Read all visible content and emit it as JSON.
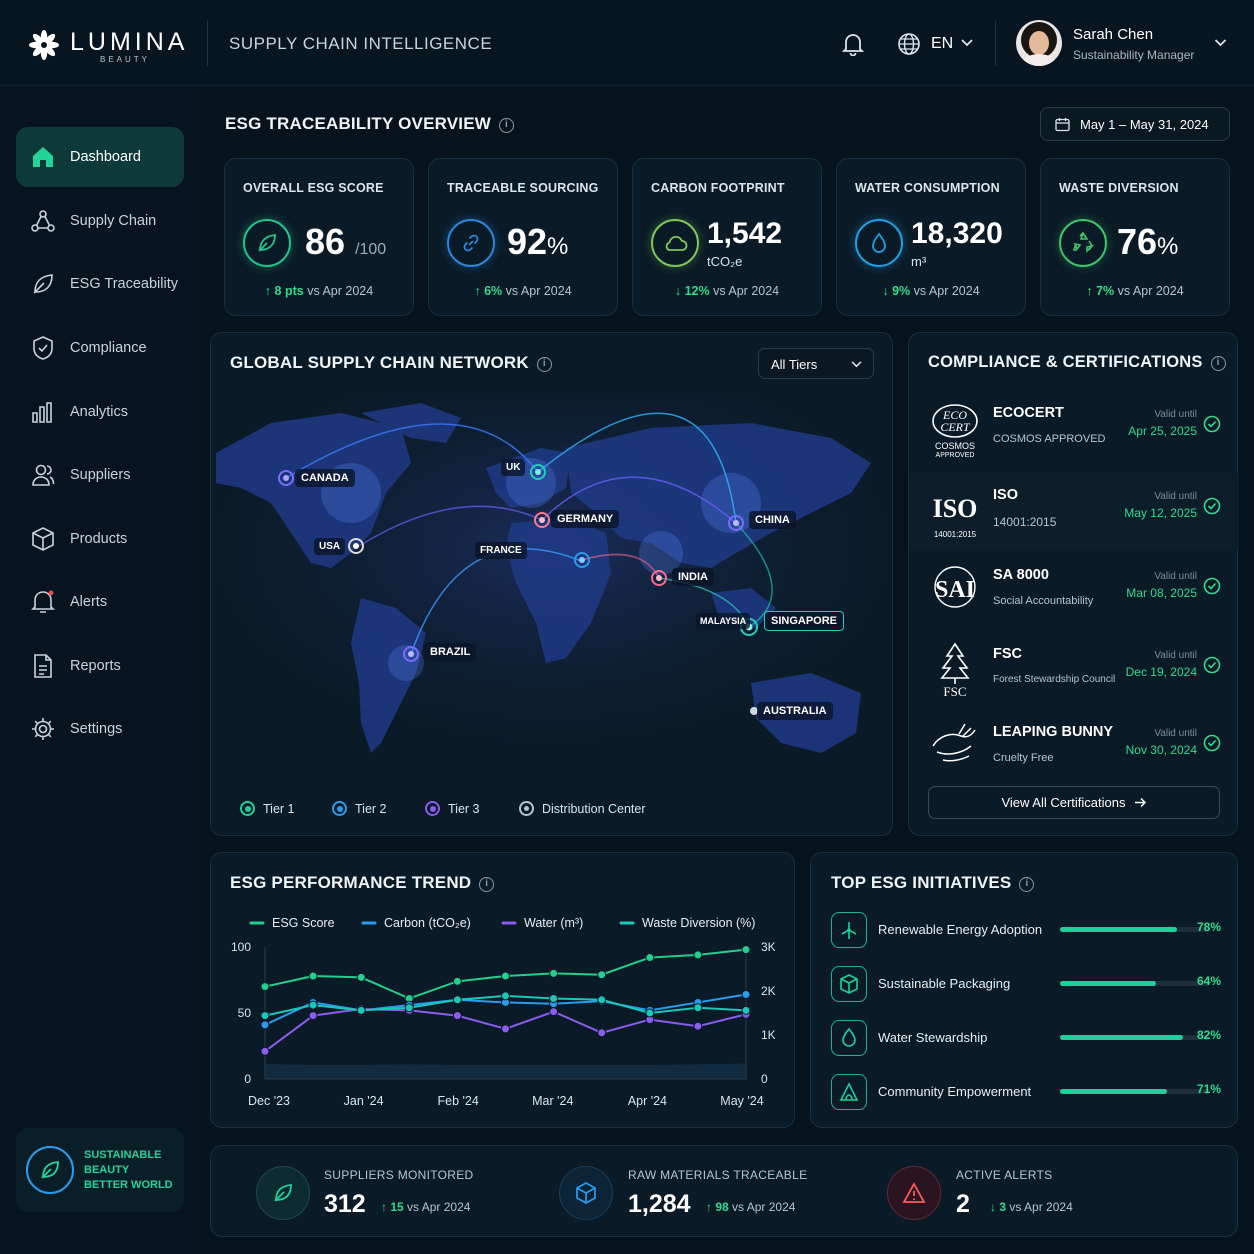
{
  "brand": {
    "name": "LUMINA",
    "sub": "BEAUTY"
  },
  "header": {
    "section": "SUPPLY CHAIN INTELLIGENCE",
    "lang": "EN",
    "user_name": "Sarah Chen",
    "user_role": "Sustainability Manager"
  },
  "sidebar": {
    "items": [
      {
        "label": "Dashboard",
        "icon": "home-icon"
      },
      {
        "label": "Supply Chain",
        "icon": "network-icon"
      },
      {
        "label": "ESG Traceability",
        "icon": "leaf-icon"
      },
      {
        "label": "Compliance",
        "icon": "shield-check-icon"
      },
      {
        "label": "Analytics",
        "icon": "bar-chart-icon"
      },
      {
        "label": "Suppliers",
        "icon": "users-icon"
      },
      {
        "label": "Products",
        "icon": "box-icon"
      },
      {
        "label": "Alerts",
        "icon": "bell-icon"
      },
      {
        "label": "Reports",
        "icon": "document-icon"
      },
      {
        "label": "Settings",
        "icon": "gear-icon"
      }
    ],
    "badge": {
      "l1": "SUSTAINABLE",
      "l2": "BEAUTY",
      "l3": "BETTER WORLD"
    }
  },
  "overview": {
    "title": "ESG TRACEABILITY OVERVIEW",
    "date_range": "May 1 – May 31, 2024"
  },
  "kpis": [
    {
      "title": "OVERALL ESG SCORE",
      "value": "86",
      "unit": "/100",
      "delta": "8 pts",
      "compare": "vs Apr 2024",
      "dir": "up",
      "color": "#23c48a",
      "icon": "leaf-icon"
    },
    {
      "title": "TRACEABLE SOURCING",
      "value": "92",
      "unit": "%",
      "delta": "6%",
      "compare": "vs Apr 2024",
      "dir": "up",
      "color": "#2a86e0",
      "icon": "link-icon"
    },
    {
      "title": "CARBON FOOTPRINT",
      "value": "1,542",
      "unit": "tCO₂e",
      "delta": "12%",
      "compare": "vs Apr 2024",
      "dir": "down",
      "color": "#7ec85a",
      "icon": "cloud-icon"
    },
    {
      "title": "WATER CONSUMPTION",
      "value": "18,320",
      "unit": "m³",
      "delta": "9%",
      "compare": "vs Apr 2024",
      "dir": "down",
      "color": "#1ea0e8",
      "icon": "water-drop-icon"
    },
    {
      "title": "WASTE DIVERSION",
      "value": "76",
      "unit": "%",
      "delta": "7%",
      "compare": "vs Apr 2024",
      "dir": "up",
      "color": "#3fc46a",
      "icon": "recycle-icon"
    }
  ],
  "network": {
    "title": "GLOBAL SUPPLY CHAIN NETWORK",
    "filter": "All Tiers",
    "locations": [
      "CANADA",
      "USA",
      "UK",
      "GERMANY",
      "FRANCE",
      "CHINA",
      "INDIA",
      "SINGAPORE",
      "MALAYSIA",
      "BRAZIL",
      "AUSTRALIA"
    ],
    "legend": [
      "Tier 1",
      "Tier 2",
      "Tier 3",
      "Distribution Center"
    ]
  },
  "compliance": {
    "title": "COMPLIANCE & CERTIFICATIONS",
    "valid_label": "Valid until",
    "button": "View All Certifications",
    "items": [
      {
        "name": "ECOCERT",
        "sub": "COSMOS APPROVED",
        "date": "Apr 25, 2025",
        "logo": "ecocert-logo"
      },
      {
        "name": "ISO",
        "sub": "14001:2015",
        "date": "May 12, 2025",
        "logo": "iso-logo"
      },
      {
        "name": "SA 8000",
        "sub": "Social Accountability",
        "date": "Mar 08, 2025",
        "logo": "sa8000-logo"
      },
      {
        "name": "FSC",
        "sub": "Forest Stewardship Council",
        "date": "Dec 19, 2024",
        "logo": "fsc-tree-logo"
      },
      {
        "name": "LEAPING BUNNY",
        "sub": "Cruelty Free",
        "date": "Nov 30, 2024",
        "logo": "leaping-bunny-logo"
      }
    ]
  },
  "trend": {
    "title": "ESG PERFORMANCE TREND"
  },
  "chart_data": {
    "type": "line",
    "title": "ESG PERFORMANCE TREND",
    "x": [
      "Dec '23",
      "",
      "Jan '24",
      "",
      "Feb '24",
      "",
      "Mar '24",
      "",
      "Apr '24",
      "",
      "May '24"
    ],
    "x_ticks": [
      "Dec '23",
      "Jan '24",
      "Feb '24",
      "Mar '24",
      "Apr '24",
      "May '24"
    ],
    "y_left": {
      "ticks": [
        "100",
        "50",
        "0"
      ],
      "range": [
        0,
        100
      ]
    },
    "y_right": {
      "ticks": [
        "3K",
        "2K",
        "1K",
        "0"
      ],
      "range": [
        0,
        3000
      ]
    },
    "series": [
      {
        "name": "ESG Score",
        "color": "#22d08e",
        "axis": "left",
        "values": [
          70,
          78,
          77,
          61,
          74,
          78,
          80,
          79,
          92,
          94,
          98
        ]
      },
      {
        "name": "Carbon (tCO₂e)",
        "color": "#2a9cf0",
        "axis": "left",
        "values": [
          41,
          58,
          52,
          56,
          60,
          58,
          57,
          59,
          52,
          58,
          64
        ]
      },
      {
        "name": "Water (m³)",
        "color": "#8a5cf0",
        "axis": "left",
        "values": [
          21,
          48,
          53,
          52,
          48,
          38,
          51,
          35,
          45,
          40,
          49
        ]
      },
      {
        "name": "Waste Diversion (%)",
        "color": "#18c8b8",
        "axis": "left",
        "values": [
          48,
          56,
          52,
          54,
          60,
          63,
          61,
          60,
          50,
          54,
          52
        ]
      }
    ]
  },
  "initiatives": {
    "title": "TOP ESG INITIATIVES",
    "items": [
      {
        "name": "Renewable Energy Adoption",
        "pct": 78,
        "label": "78%",
        "icon": "wind-icon"
      },
      {
        "name": "Sustainable Packaging",
        "pct": 64,
        "label": "64%",
        "icon": "package-icon"
      },
      {
        "name": "Water Stewardship",
        "pct": 82,
        "label": "82%",
        "icon": "water-drop-icon"
      },
      {
        "name": "Community Empowerment",
        "pct": 71,
        "label": "71%",
        "icon": "community-icon"
      }
    ]
  },
  "stats": [
    {
      "label": "SUPPLIERS MONITORED",
      "value": "312",
      "delta": "15",
      "compare": "vs Apr 2024",
      "dir": "up",
      "icon": "leaf-icon"
    },
    {
      "label": "RAW MATERIALS TRACEABLE",
      "value": "1,284",
      "delta": "98",
      "compare": "vs Apr 2024",
      "dir": "up",
      "icon": "cube-icon"
    },
    {
      "label": "ACTIVE ALERTS",
      "value": "2",
      "delta": "3",
      "compare": "vs Apr 2024",
      "dir": "down",
      "icon": "warning-icon"
    }
  ]
}
